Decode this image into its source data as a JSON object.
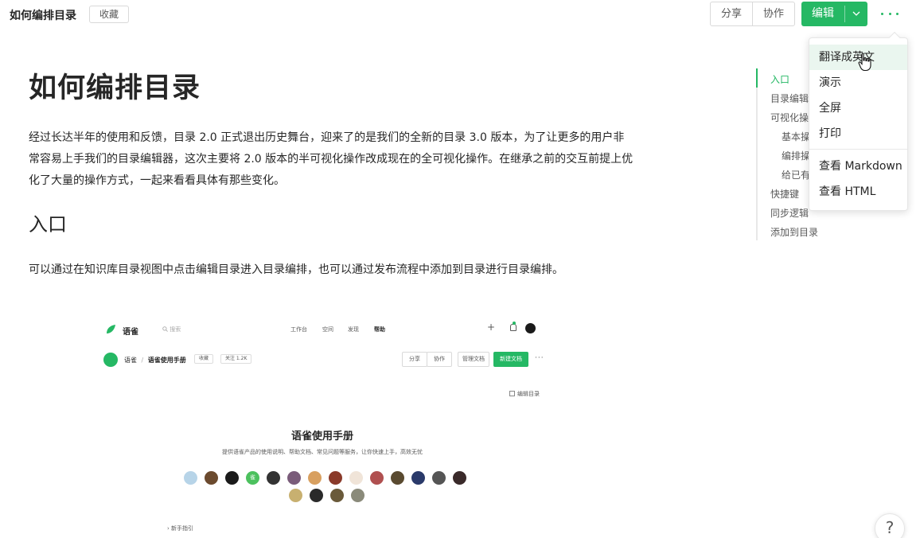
{
  "header": {
    "title": "如何编排目录",
    "favorite_label": "收藏",
    "share_label": "分享",
    "collab_label": "协作",
    "edit_label": "编辑",
    "accent_color": "#25b864"
  },
  "article": {
    "title": "如何编排目录",
    "intro": "经过长达半年的使用和反馈，目录 2.0 正式退出历史舞台，迎来了的是我们的全新的目录 3.0 版本，为了让更多的用户非常容易上手我们的目录编辑器，这次主要将 2.0 版本的半可视化操作改成现在的全可视化操作。在继承之前的交互前提上优化了大量的操作方式，一起来看看具体有那些变化。",
    "section_heading": "入口",
    "section_body": "可以通过在知识库目录视图中点击编辑目录进入目录编排，也可以通过发布流程中添加到目录进行目录编排。"
  },
  "embedded": {
    "brand": "语雀",
    "search_placeholder": "搜索",
    "nav": [
      "工作台",
      "空间",
      "发现",
      "帮助"
    ],
    "crumb_root": "语雀",
    "crumb_sep": "/",
    "crumb_book": "语雀使用手册",
    "tag_fav": "收藏",
    "tag_follow": "关注 1.2K",
    "btn_share": "分享",
    "btn_collab": "协作",
    "btn_manage": "管理文档",
    "btn_new": "新建文档",
    "toc_link": "编辑目录",
    "book_title": "语雀使用手册",
    "book_desc": "提供语雀产品的使用说明、帮助文档、常见问题等服务，让你快速上手，高效无忧",
    "guide": "新手指引",
    "member_badge": "雀"
  },
  "toc": {
    "items": [
      "入口",
      "目录编辑器",
      "可视化操作",
      "基本操作",
      "编排操作",
      "给已有",
      "快捷键",
      "同步逻辑",
      "添加到目录"
    ],
    "active": "入口"
  },
  "menu": {
    "items": [
      "翻译成英文",
      "演示",
      "全屏",
      "打印",
      "查看 Markdown",
      "查看 HTML"
    ],
    "highlighted": "翻译成英文"
  },
  "help_label": "?"
}
